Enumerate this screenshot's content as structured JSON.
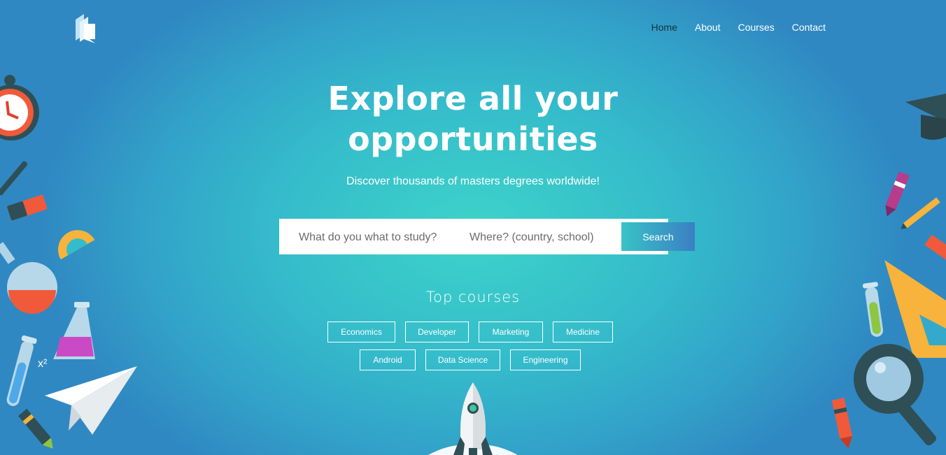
{
  "header": {
    "logo_icon": "book-logo-icon",
    "nav": [
      {
        "label": "Home",
        "active": true
      },
      {
        "label": "About",
        "active": false
      },
      {
        "label": "Courses",
        "active": false
      },
      {
        "label": "Contact",
        "active": false
      }
    ]
  },
  "hero": {
    "title_line1": "Explore all your",
    "title_line2": "opportunities",
    "subtitle": "Discover thousands of masters degrees worldwide!"
  },
  "search": {
    "study_placeholder": "What do you what to study?",
    "where_placeholder": "Where? (country, school)",
    "button_label": "Search"
  },
  "top_courses": {
    "title": "Top courses",
    "tags": [
      "Economics",
      "Developer",
      "Marketing",
      "Medicine",
      "Android",
      "Data Science",
      "Engineering"
    ]
  },
  "colors": {
    "accent_center": "#3dd3c9",
    "accent_edge": "#3088c2",
    "active_nav": "#16323a"
  }
}
